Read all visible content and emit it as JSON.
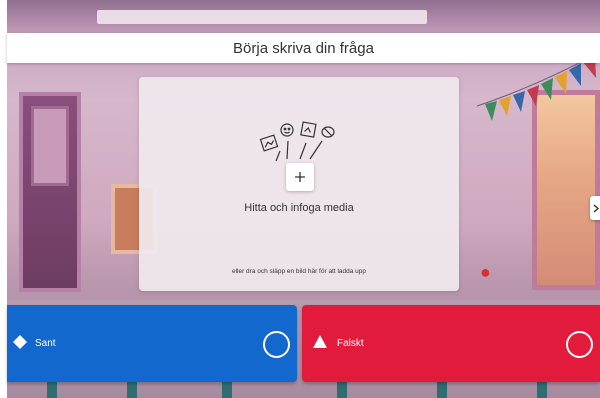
{
  "question": {
    "placeholder": "Börja skriva din fråga"
  },
  "media": {
    "title": "Hitta och infoga media",
    "hint": "eller dra och släpp en bild här för att ladda upp",
    "add_icon": "plus-icon",
    "illustration_icon": "media-types-icon"
  },
  "navigation": {
    "next_icon": "chevron-right-icon"
  },
  "answers": [
    {
      "label": "Sant",
      "shape": "diamond-icon",
      "color": "#1368ce"
    },
    {
      "label": "Falskt",
      "shape": "triangle-icon",
      "color": "#e21b3c"
    }
  ],
  "colors": {
    "question_bar": "#ffffff",
    "panel": "#f0e8ee",
    "text": "#333333"
  }
}
